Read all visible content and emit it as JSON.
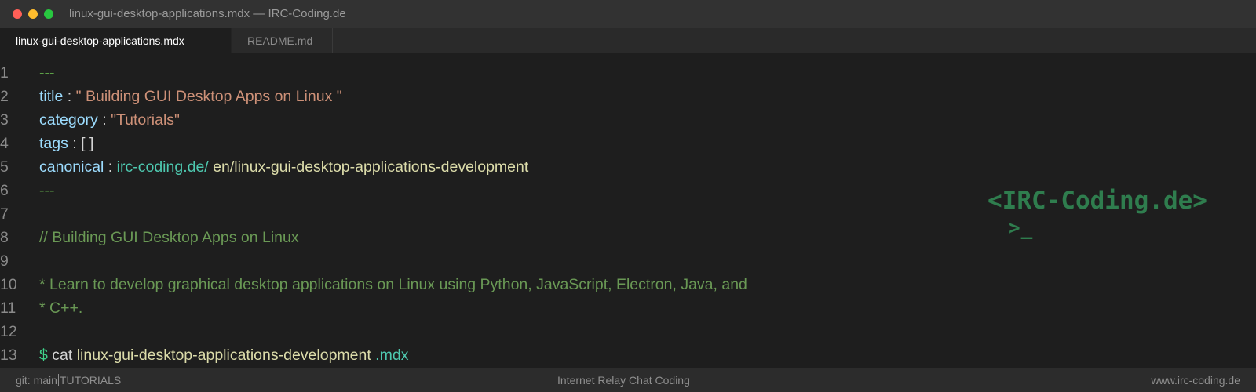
{
  "window": {
    "title": "linux-gui-desktop-applications.mdx — IRC-Coding.de"
  },
  "tabs": [
    {
      "label": "linux-gui-desktop-applications.mdx",
      "active": true
    },
    {
      "label": "README.md",
      "active": false
    }
  ],
  "editor": {
    "line_numbers": [
      "1",
      "2",
      "3",
      "4",
      "5",
      "6",
      "7",
      "8",
      "9",
      "10",
      "11",
      "12",
      "13"
    ],
    "lines": {
      "l1": {
        "dashes": "---"
      },
      "l2": {
        "key": "title",
        "colon": " : ",
        "value": "\" Building GUI Desktop Apps on Linux \""
      },
      "l3": {
        "key": "category",
        "colon": " : ",
        "value": "\"Tutorials\""
      },
      "l4": {
        "key": "tags",
        "colon": " : ",
        "value": "[ ]"
      },
      "l5": {
        "key": "canonical",
        "colon": " : ",
        "link": "irc-coding.de/",
        "path": " en/linux-gui-desktop-applications-development"
      },
      "l6": {
        "dashes": "---"
      },
      "l8": {
        "comment": "// Building GUI Desktop Apps on Linux"
      },
      "l10": {
        "comment": "* Learn to develop graphical desktop applications on Linux using Python, JavaScript, Electron, Java, and"
      },
      "l11": {
        "comment": "* C++."
      },
      "l13": {
        "prompt": "$",
        "cmd": " cat ",
        "file": "linux-gui-desktop-applications-development",
        "ext": " .mdx"
      }
    }
  },
  "logo": {
    "line1": "<IRC-Coding.de>",
    "line2": ">_"
  },
  "statusbar": {
    "branch": "git: main",
    "category": "TUTORIALS",
    "center": "Internet Relay Chat Coding",
    "right": "www.irc-coding.de"
  },
  "colors": {
    "background": "#1e1e1e",
    "key": "#9cdcfe",
    "string": "#ce9178",
    "link": "#4ec9b0",
    "path": "#dcdcaa",
    "comment": "#6a9955",
    "logo": "#2f7d4e"
  }
}
